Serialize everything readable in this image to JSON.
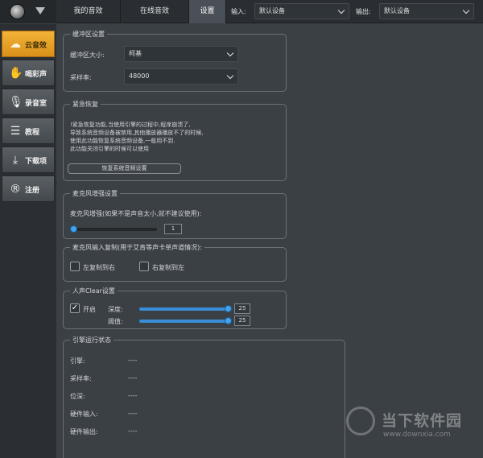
{
  "topbar": {
    "tabs": [
      {
        "label": "我的音效",
        "active": false
      },
      {
        "label": "在线音效",
        "active": false
      },
      {
        "label": "设置",
        "active": true
      }
    ],
    "input_label": "输入:",
    "input_value": "默认设备",
    "output_label": "输出:",
    "output_value": "默认设备"
  },
  "sidebar": {
    "items": [
      {
        "label": "云音效",
        "icon": "cloud-icon",
        "active": true
      },
      {
        "label": "喝彩声",
        "icon": "clap-icon",
        "active": false
      },
      {
        "label": "录音室",
        "icon": "microphone-icon",
        "active": false
      },
      {
        "label": "教程",
        "icon": "book-icon",
        "active": false
      },
      {
        "label": "下载项",
        "icon": "download-icon",
        "active": false
      },
      {
        "label": "注册",
        "icon": "register-icon",
        "active": false
      }
    ]
  },
  "buffer": {
    "title": "缓冲区设置",
    "size_label": "缓冲区大小:",
    "size_value": "柯基",
    "rate_label": "采样率:",
    "rate_value": "48000"
  },
  "recovery": {
    "title": "紧急恢复",
    "lines": [
      "!紧急恢复功能,当使用引擎的过程中,程序崩溃了,",
      "导致系统音频设备被禁用,其他播放器播放不了的时候,",
      "使用此功能恢复系统音频设备,一般用不到.",
      "此功能关闭引擎的时候可以使用"
    ],
    "button": "恢复系统音频设置"
  },
  "mic_boost": {
    "title": "麦克风增强设置",
    "desc": "麦克风增强(如果不是声音太小,就不建议使用):",
    "value": "1",
    "level": 0
  },
  "mic_copy": {
    "title": "麦克风输入复制(用于艾肯等声卡单声道情况):",
    "left_to_right": "左复制到右",
    "right_to_left": "右复制到左"
  },
  "clear": {
    "title": "人声Clear设置",
    "enable_label": "开启",
    "enabled": true,
    "depth_label": "深度:",
    "depth_value": "25",
    "depth_level": 1.0,
    "threshold_label": "阈值:",
    "threshold_value": "25",
    "threshold_level": 1.0
  },
  "engine": {
    "title": "引擎运行状态",
    "rows": [
      {
        "label": "引擎:",
        "value": "----"
      },
      {
        "label": "采样率:",
        "value": "----"
      },
      {
        "label": "位深:",
        "value": "----"
      },
      {
        "label": "硬件输入:",
        "value": "----"
      },
      {
        "label": "硬件输出:",
        "value": "----"
      }
    ]
  },
  "watermark": {
    "brand": "当下软件园",
    "url": "www.downxia.com"
  }
}
